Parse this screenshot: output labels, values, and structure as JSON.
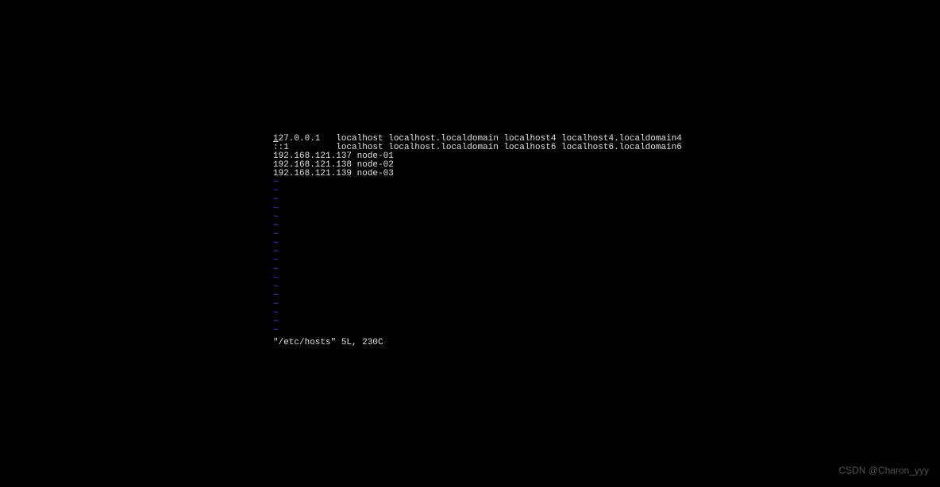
{
  "file_lines": [
    "127.0.0.1   localhost localhost.localdomain localhost4 localhost4.localdomain4",
    "::1         localhost localhost.localdomain localhost6 localhost6.localdomain6",
    "192.168.121.137 node-01",
    "192.168.121.138 node-02",
    "192.168.121.139 node-03"
  ],
  "cursor": {
    "line": 0,
    "col": 0
  },
  "tilde_count": 18,
  "tilde_char": "~",
  "status_line": "\"/etc/hosts\" 5L, 230C",
  "watermark": "CSDN @Charon_yyy"
}
